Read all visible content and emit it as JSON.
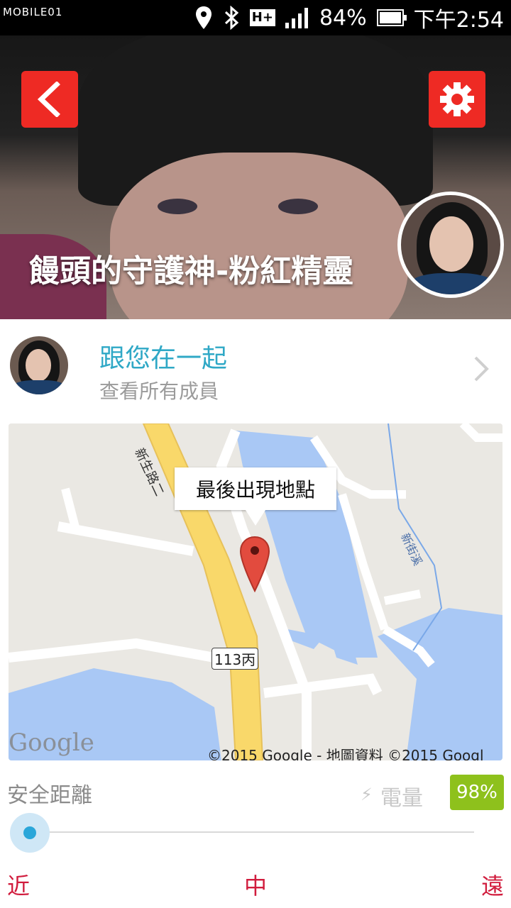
{
  "status_bar": {
    "brand": "MOBILE01",
    "network": "H+",
    "battery_percent": "84%",
    "time": "下午2:54"
  },
  "header": {
    "title": "饅頭的守護神-粉紅精靈",
    "back_icon": "chevron-left-icon",
    "settings_icon": "gear-icon",
    "accent_color": "#ee2a24"
  },
  "together": {
    "title": "跟您在一起",
    "subtitle": "查看所有成員",
    "title_color": "#2fa8c6"
  },
  "map": {
    "callout": "最後出現地點",
    "road_label_1": "新生路二",
    "road_label_2": "113丙",
    "river_label": "新街溪",
    "google": "Google",
    "copyright": "©2015 Google - 地圖資料 ©2015 Googl"
  },
  "bottom": {
    "safe_distance_label": "安全距離",
    "power_label": "電量",
    "battery_level": "98%",
    "battery_color": "#8ec11c",
    "slider_value": 0,
    "scale_near": "近",
    "scale_mid": "中",
    "scale_far": "遠",
    "scale_color": "#d11c3d"
  }
}
